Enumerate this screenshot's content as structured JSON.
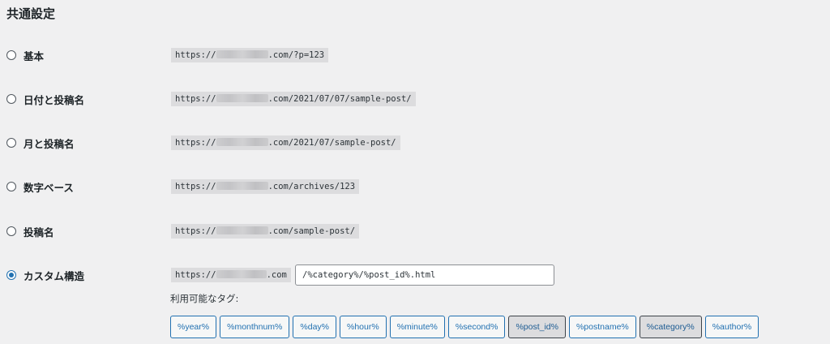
{
  "section_title": "共通設定",
  "options": [
    {
      "label": "基本",
      "url_prefix": "https://",
      "url_suffix": ".com/?p=123",
      "checked": false
    },
    {
      "label": "日付と投稿名",
      "url_prefix": "https://",
      "url_suffix": ".com/2021/07/07/sample-post/",
      "checked": false
    },
    {
      "label": "月と投稿名",
      "url_prefix": "https://",
      "url_suffix": ".com/2021/07/sample-post/",
      "checked": false
    },
    {
      "label": "数字ベース",
      "url_prefix": "https://",
      "url_suffix": ".com/archives/123",
      "checked": false
    },
    {
      "label": "投稿名",
      "url_prefix": "https://",
      "url_suffix": ".com/sample-post/",
      "checked": false
    },
    {
      "label": "カスタム構造",
      "url_prefix": "https://",
      "url_suffix": ".com",
      "checked": true
    }
  ],
  "custom_structure": {
    "value": "/%category%/%post_id%.html"
  },
  "available_tags_label": "利用可能なタグ:",
  "tags": [
    {
      "label": "%year%",
      "active": false
    },
    {
      "label": "%monthnum%",
      "active": false
    },
    {
      "label": "%day%",
      "active": false
    },
    {
      "label": "%hour%",
      "active": false
    },
    {
      "label": "%minute%",
      "active": false
    },
    {
      "label": "%second%",
      "active": false
    },
    {
      "label": "%post_id%",
      "active": true
    },
    {
      "label": "%postname%",
      "active": false
    },
    {
      "label": "%category%",
      "active": true
    },
    {
      "label": "%author%",
      "active": false
    }
  ],
  "colors": {
    "accent": "#2271b1",
    "background": "#f0f0f1",
    "code_bg": "#dcdcde"
  }
}
